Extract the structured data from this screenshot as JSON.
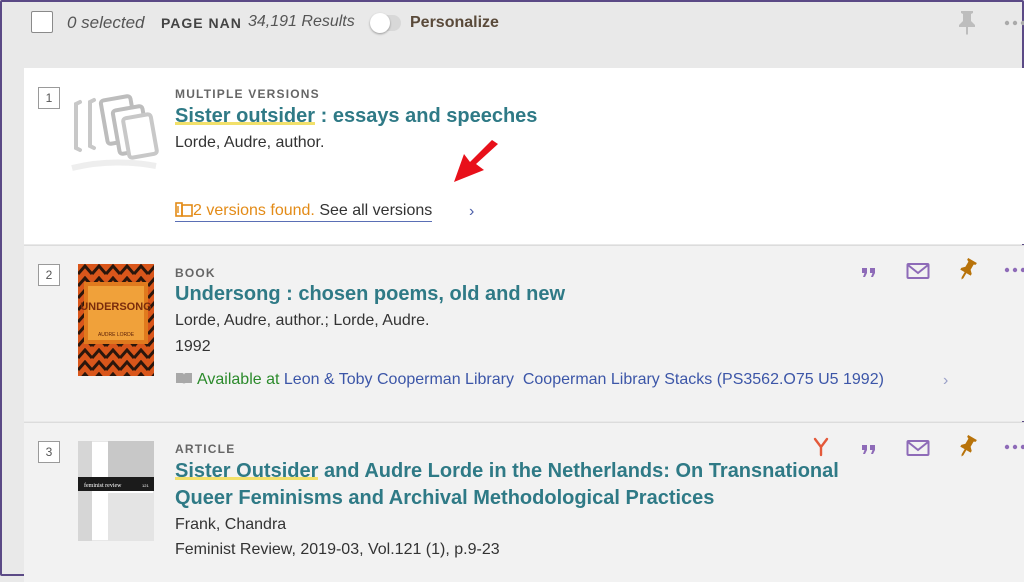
{
  "toolbar": {
    "selected_text": "0 selected",
    "page_label": "PAGE NAN",
    "results_count": "34,191 Results",
    "personalize_label": "Personalize",
    "personalize_on": false
  },
  "results": [
    {
      "number": "1",
      "type": "MULTIPLE VERSIONS",
      "title_highlight": "Sister outsider",
      "title_rest": " : essays and speeches",
      "author": "Lorde, Audre, author.",
      "versions_found": "2 versions found.",
      "see_all": "See all versions"
    },
    {
      "number": "2",
      "type": "BOOK",
      "title": "Undersong : chosen poems, old and new",
      "author": "Lorde, Audre, author.; Lorde, Audre.",
      "year": "1992",
      "available_label": "Available at",
      "library": "Leon & Toby Cooperman Library",
      "location": "Cooperman Library Stacks (PS3562.O75 U5 1992)",
      "cover_title": "UNDERSONG",
      "cover_author": "AUDRE LORDE"
    },
    {
      "number": "3",
      "type": "ARTICLE",
      "title_highlight": "Sister Outsider",
      "title_line1_rest": " and Audre Lorde in the Netherlands: On Transnational",
      "title_line2": "Queer Feminisms and Archival Methodological Practices",
      "author": "Frank, Chandra",
      "source": "Feminist Review, 2019-03, Vol.121 (1), p.9-23",
      "cover_journal": "feminist review",
      "cover_issue": "121"
    }
  ],
  "colors": {
    "accent_teal": "#2f7a86",
    "available_green": "#2b8a2b",
    "versions_orange": "#e38b17",
    "action_purple": "#8e6bb8",
    "pin_brown": "#b8730a",
    "annotation_red": "#e8101a"
  }
}
